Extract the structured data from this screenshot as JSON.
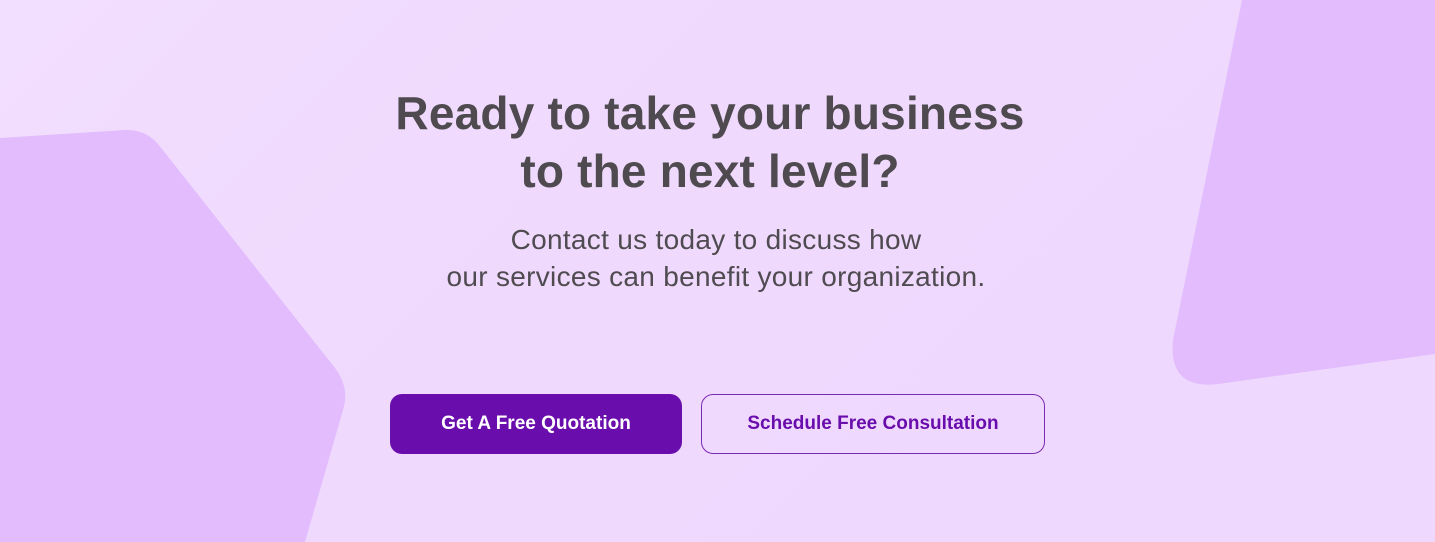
{
  "colors": {
    "background": "#efd9fd",
    "shape": "#e2bcfc",
    "heading_text": "#4e4a4f",
    "accent": "#6a0dad",
    "button_text_light": "#ffffff"
  },
  "cta": {
    "headline": {
      "line1": "Ready to take your business",
      "line2": "to the next level?"
    },
    "subtext": {
      "line1": "Contact us today to discuss how",
      "line2": "our services can benefit your organization."
    },
    "buttons": {
      "primary_label": "Get A Free Quotation",
      "secondary_label": "Schedule Free Consultation"
    }
  }
}
